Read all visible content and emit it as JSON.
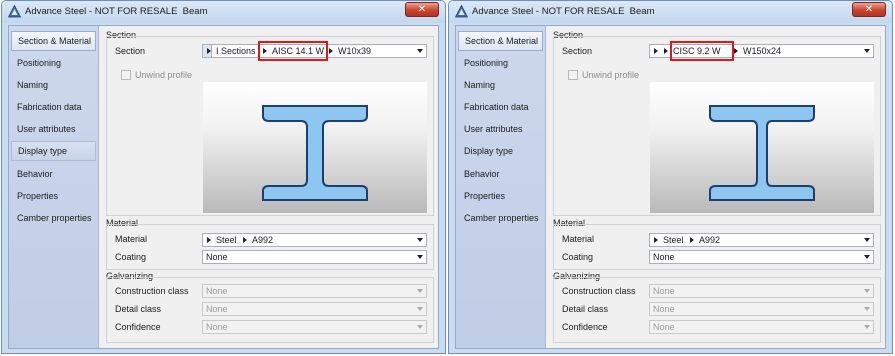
{
  "windows": [
    {
      "title": "Advance Steel - NOT FOR RESALE  Beam",
      "close_glyph": "✕",
      "nav": [
        {
          "label": "Section & Material"
        },
        {
          "label": "Positioning"
        },
        {
          "label": "Naming"
        },
        {
          "label": "Fabrication data"
        },
        {
          "label": "User attributes"
        },
        {
          "label": "Display type"
        },
        {
          "label": "Behavior"
        },
        {
          "label": "Properties"
        },
        {
          "label": "Camber properties"
        }
      ],
      "section": {
        "group_title": "Section",
        "label": "Section",
        "path": [
          "I Sections",
          "AISC 14.1 W",
          "W10x39"
        ],
        "highlighted": "AISC 14.1 W",
        "unwind_label": "Unwind profile"
      },
      "material": {
        "group_title": "Material",
        "material_label": "Material",
        "material_path": [
          "Steel",
          "A992"
        ],
        "coating_label": "Coating",
        "coating_value": "None"
      },
      "galvanizing": {
        "group_title": "Galvanizing",
        "construction_label": "Construction class",
        "construction_value": "None",
        "detail_label": "Detail class",
        "detail_value": "None",
        "confidence_label": "Confidence",
        "confidence_value": "None"
      }
    },
    {
      "title": "Advance Steel - NOT FOR RESALE  Beam",
      "close_glyph": "✕",
      "nav": [
        {
          "label": "Section & Material"
        },
        {
          "label": "Positioning"
        },
        {
          "label": "Naming"
        },
        {
          "label": "Fabrication data"
        },
        {
          "label": "User attributes"
        },
        {
          "label": "Display type"
        },
        {
          "label": "Behavior"
        },
        {
          "label": "Properties"
        },
        {
          "label": "Camber properties"
        }
      ],
      "section": {
        "group_title": "Section",
        "label": "Section",
        "path": [
          "",
          "CISC 9.2 W",
          "W150x24"
        ],
        "highlighted": "CISC 9.2 W",
        "unwind_label": "Unwind profile"
      },
      "material": {
        "group_title": "Material",
        "material_label": "Material",
        "material_path": [
          "Steel",
          "A992"
        ],
        "coating_label": "Coating",
        "coating_value": "None"
      },
      "galvanizing": {
        "group_title": "Galvanizing",
        "construction_label": "Construction class",
        "construction_value": "None",
        "detail_label": "Detail class",
        "detail_value": "None",
        "confidence_label": "Confidence",
        "confidence_value": "None"
      }
    }
  ],
  "colors": {
    "highlight_box": "#e01818",
    "beam_fill": "#8ec6f2",
    "beam_stroke": "#1d3f6e",
    "window_frame": "#c9dcf1"
  },
  "icons": {
    "app_icon": "advance-steel-logo",
    "close": "close-icon",
    "path_separator": "triangle-right-icon",
    "dropdown": "chevron-down-icon"
  }
}
